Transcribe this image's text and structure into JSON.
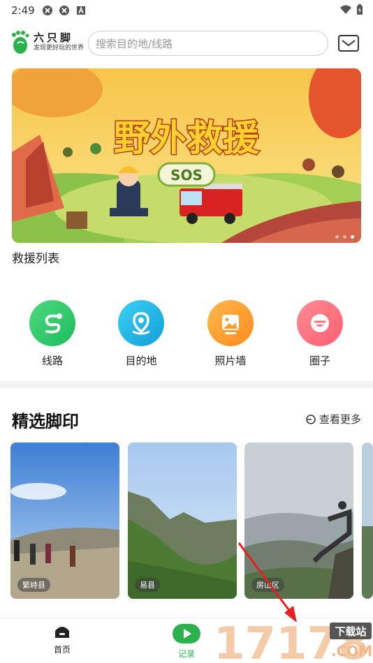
{
  "status_bar": {
    "time": "2:49",
    "icons": [
      "sync-icon",
      "sync-icon",
      "a-badge-icon",
      "wifi-icon",
      "battery-icon"
    ]
  },
  "header": {
    "logo_name": "六只脚",
    "logo_tagline": "发现更好玩的世界",
    "search_placeholder": "搜索目的地/线路",
    "message_icon": "mail-icon"
  },
  "banner": {
    "headline": "野外救援",
    "badge": "SOS",
    "caption": "救援列表",
    "dots": 3,
    "active_dot": 2
  },
  "categories": [
    {
      "label": "线路",
      "icon": "route-icon",
      "color": "#2bc96b"
    },
    {
      "label": "目的地",
      "icon": "location-pin-icon",
      "color": "#1fb6e6"
    },
    {
      "label": "照片墙",
      "icon": "photo-icon",
      "color": "#ff9d2b"
    },
    {
      "label": "圈子",
      "icon": "chat-face-icon",
      "color": "#ff6f7e"
    }
  ],
  "section": {
    "title": "精选脚印",
    "more_label": "查看更多"
  },
  "cards": [
    {
      "location": "繁峙县"
    },
    {
      "location": "易县"
    },
    {
      "location": "房山区"
    }
  ],
  "bottom_nav": {
    "items": [
      {
        "label": "首页",
        "icon": "home-icon"
      },
      {
        "label": "记录",
        "icon": "record-play-icon"
      }
    ]
  },
  "watermark": {
    "number": "17178",
    "site_label": "下载站",
    "domain": ".COM"
  },
  "colors": {
    "brand_green": "#2bb24c",
    "text_dark": "#222222"
  }
}
